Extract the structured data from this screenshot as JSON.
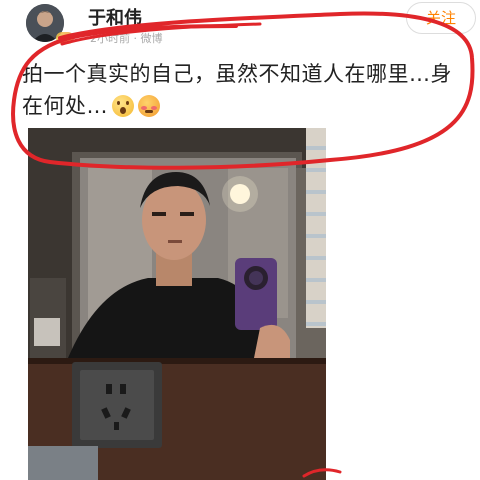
{
  "post": {
    "username": "于和伟",
    "meta": "2小时前 · 微博",
    "follow_label": "关注",
    "text": "拍一个真实的自己，虽然不知道人在哪里…身在何处…",
    "emojis": [
      "surprised-face-emoji",
      "flushed-face-emoji"
    ]
  },
  "annotation": {
    "color": "#e0262a"
  },
  "photo": {
    "icon": "selfie-photo"
  }
}
